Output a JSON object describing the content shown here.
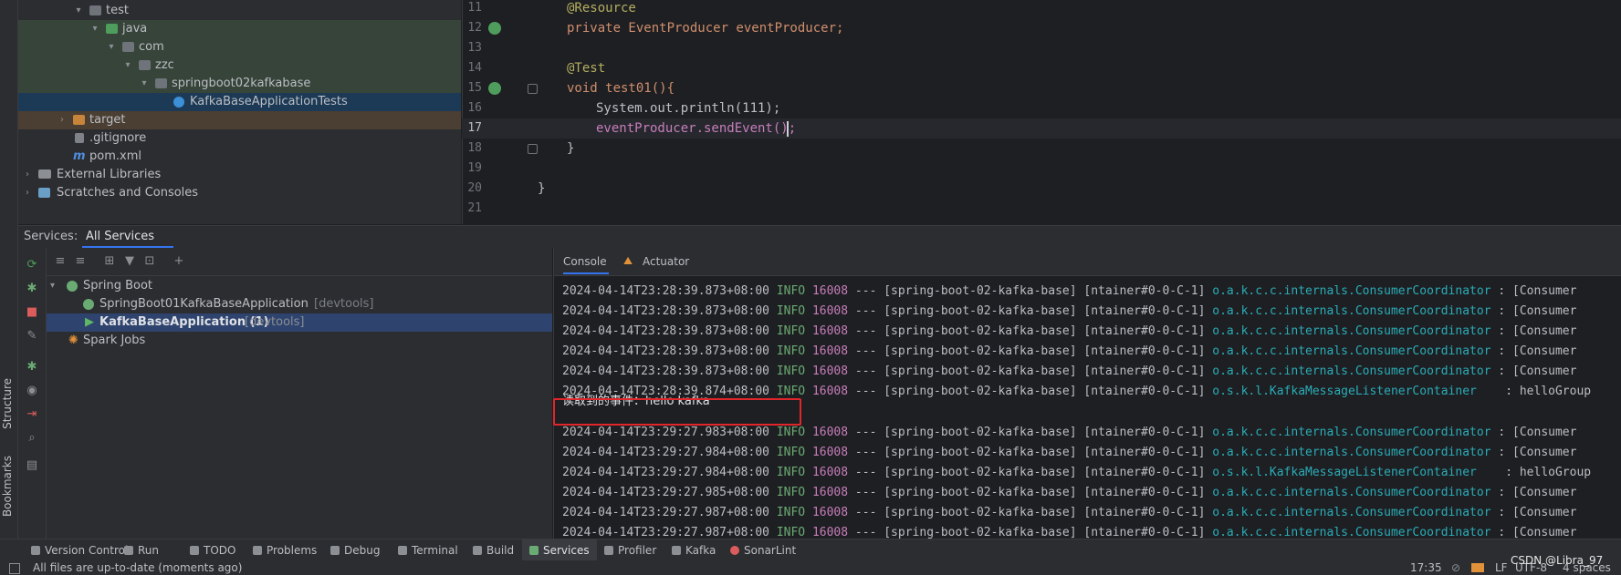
{
  "project_tree": {
    "items": [
      {
        "label": "test",
        "kind": "folder"
      },
      {
        "label": "java",
        "kind": "folder-green"
      },
      {
        "label": "com",
        "kind": "folder"
      },
      {
        "label": "zzc",
        "kind": "folder"
      },
      {
        "label": "springboot02kafkabase",
        "kind": "folder"
      },
      {
        "label": "KafkaBaseApplicationTests",
        "kind": "class"
      },
      {
        "label": "target",
        "kind": "folder-orange"
      },
      {
        "label": ".gitignore",
        "kind": "file"
      },
      {
        "label": "pom.xml",
        "kind": "maven"
      },
      {
        "label": "External Libraries",
        "kind": "library"
      },
      {
        "label": "Scratches and Consoles",
        "kind": "scratch"
      }
    ]
  },
  "editor": {
    "lines": [
      {
        "num": "11",
        "text": "@Resource"
      },
      {
        "num": "12",
        "text": "private EventProducer eventProducer;"
      },
      {
        "num": "13",
        "text": ""
      },
      {
        "num": "14",
        "text": "@Test"
      },
      {
        "num": "15",
        "text": "void test01(){"
      },
      {
        "num": "16",
        "text": "System.out.println(111);"
      },
      {
        "num": "17",
        "text": "eventProducer.sendEvent();"
      },
      {
        "num": "18",
        "text": "}"
      },
      {
        "num": "19",
        "text": ""
      },
      {
        "num": "20",
        "text": "}"
      },
      {
        "num": "21",
        "text": ""
      }
    ]
  },
  "services": {
    "label": "Services:",
    "tab": "All Services",
    "tree": [
      {
        "label": "Spring Boot",
        "suffix": ""
      },
      {
        "label": "SpringBoot01KafkaBaseApplication",
        "suffix": "[devtools]"
      },
      {
        "label": "KafkaBaseApplication (1)",
        "suffix": "[devtools]"
      },
      {
        "label": "Spark Jobs",
        "suffix": ""
      }
    ]
  },
  "console": {
    "tabs": [
      "Console",
      "Actuator"
    ],
    "highlight_line": "读取到的事件：hello kafka",
    "logs": [
      {
        "ts": "2024-04-14T23:28:39.873+08:00",
        "level": "INFO",
        "pid": "16008",
        "sep": "---",
        "app": "[spring-boot-02-kafka-base]",
        "thread": "[ntainer#0-0-C-1]",
        "logger": "o.a.k.c.c.internals.ConsumerCoordinator",
        "msg": ": [Consumer"
      },
      {
        "ts": "2024-04-14T23:28:39.873+08:00",
        "level": "INFO",
        "pid": "16008",
        "sep": "---",
        "app": "[spring-boot-02-kafka-base]",
        "thread": "[ntainer#0-0-C-1]",
        "logger": "o.a.k.c.c.internals.ConsumerCoordinator",
        "msg": ": [Consumer"
      },
      {
        "ts": "2024-04-14T23:28:39.873+08:00",
        "level": "INFO",
        "pid": "16008",
        "sep": "---",
        "app": "[spring-boot-02-kafka-base]",
        "thread": "[ntainer#0-0-C-1]",
        "logger": "o.a.k.c.c.internals.ConsumerCoordinator",
        "msg": ": [Consumer"
      },
      {
        "ts": "2024-04-14T23:28:39.873+08:00",
        "level": "INFO",
        "pid": "16008",
        "sep": "---",
        "app": "[spring-boot-02-kafka-base]",
        "thread": "[ntainer#0-0-C-1]",
        "logger": "o.a.k.c.c.internals.ConsumerCoordinator",
        "msg": ": [Consumer"
      },
      {
        "ts": "2024-04-14T23:28:39.873+08:00",
        "level": "INFO",
        "pid": "16008",
        "sep": "---",
        "app": "[spring-boot-02-kafka-base]",
        "thread": "[ntainer#0-0-C-1]",
        "logger": "o.a.k.c.c.internals.ConsumerCoordinator",
        "msg": ": [Consumer"
      },
      {
        "ts": "2024-04-14T23:28:39.874+08:00",
        "level": "INFO",
        "pid": "16008",
        "sep": "---",
        "app": "[spring-boot-02-kafka-base]",
        "thread": "[ntainer#0-0-C-1]",
        "logger": "o.s.k.l.KafkaMessageListenerContainer",
        "msg": ": helloGroup"
      }
    ],
    "logs_after": [
      {
        "ts": "2024-04-14T23:29:27.983+08:00",
        "level": "INFO",
        "pid": "16008",
        "sep": "---",
        "app": "[spring-boot-02-kafka-base]",
        "thread": "[ntainer#0-0-C-1]",
        "logger": "o.a.k.c.c.internals.ConsumerCoordinator",
        "msg": ": [Consumer"
      },
      {
        "ts": "2024-04-14T23:29:27.984+08:00",
        "level": "INFO",
        "pid": "16008",
        "sep": "---",
        "app": "[spring-boot-02-kafka-base]",
        "thread": "[ntainer#0-0-C-1]",
        "logger": "o.a.k.c.c.internals.ConsumerCoordinator",
        "msg": ": [Consumer"
      },
      {
        "ts": "2024-04-14T23:29:27.984+08:00",
        "level": "INFO",
        "pid": "16008",
        "sep": "---",
        "app": "[spring-boot-02-kafka-base]",
        "thread": "[ntainer#0-0-C-1]",
        "logger": "o.s.k.l.KafkaMessageListenerContainer",
        "msg": ": helloGroup"
      },
      {
        "ts": "2024-04-14T23:29:27.985+08:00",
        "level": "INFO",
        "pid": "16008",
        "sep": "---",
        "app": "[spring-boot-02-kafka-base]",
        "thread": "[ntainer#0-0-C-1]",
        "logger": "o.a.k.c.c.internals.ConsumerCoordinator",
        "msg": ": [Consumer"
      },
      {
        "ts": "2024-04-14T23:29:27.987+08:00",
        "level": "INFO",
        "pid": "16008",
        "sep": "---",
        "app": "[spring-boot-02-kafka-base]",
        "thread": "[ntainer#0-0-C-1]",
        "logger": "o.a.k.c.c.internals.ConsumerCoordinator",
        "msg": ": [Consumer"
      },
      {
        "ts": "2024-04-14T23:29:27.987+08:00",
        "level": "INFO",
        "pid": "16008",
        "sep": "---",
        "app": "[spring-boot-02-kafka-base]",
        "thread": "[ntainer#0-0-C-1]",
        "logger": "o.a.k.c.c.internals.ConsumerCoordinator",
        "msg": ": [Consumer"
      }
    ]
  },
  "side_tabs": {
    "structure": "Structure",
    "bookmarks": "Bookmarks"
  },
  "bottom_tools": [
    "Version Control",
    "Run",
    "TODO",
    "Problems",
    "Debug",
    "Terminal",
    "Build",
    "Services",
    "Profiler",
    "Kafka",
    "SonarLint"
  ],
  "status": {
    "message": "All files are up-to-date (moments ago)",
    "position": "17:35",
    "line_sep": "LF",
    "encoding": "UTF-8",
    "indent": "4 spaces",
    "watermark": "CSDN @Libra_97"
  },
  "colors": {
    "accent": "#3574f0",
    "highlight_border": "#e0262a",
    "selection": "#2e436e"
  }
}
